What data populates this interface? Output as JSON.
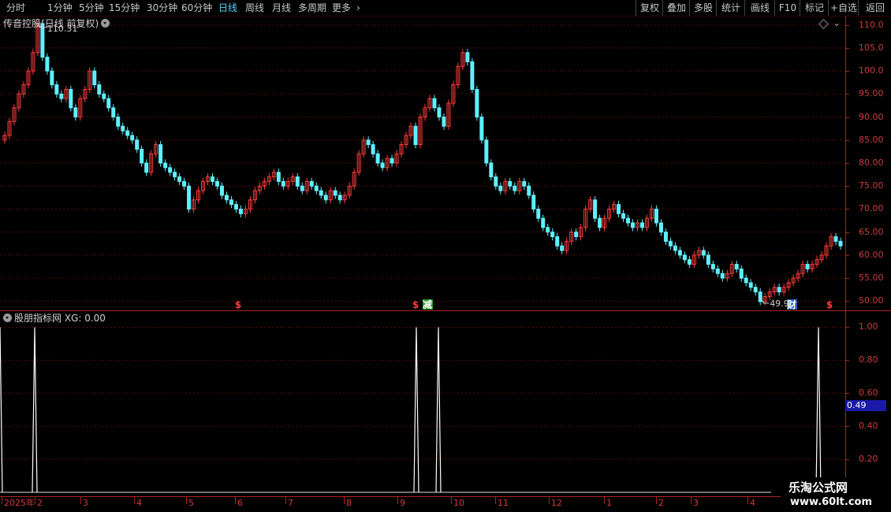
{
  "toolbar": {
    "periods": [
      "分时",
      "1分钟",
      "5分钟",
      "15分钟",
      "30分钟",
      "60分钟",
      "日线",
      "周线",
      "月线",
      "多周期",
      "更多"
    ],
    "active_period": "日线",
    "right_buttons": [
      "复权",
      "叠加",
      "多股",
      "统计",
      "画线",
      "F10",
      "标记",
      "+自选",
      "返回"
    ]
  },
  "main_panel": {
    "title": "传音控股(日线 前复权)",
    "high_label": "110.31",
    "low_label": "49.90",
    "y_ticks": [
      "110.0",
      "105.0",
      "100.0",
      "95.00",
      "90.00",
      "85.00",
      "80.00",
      "75.00",
      "70.00",
      "65.00",
      "60.00",
      "55.00",
      "50.00"
    ],
    "markers": [
      "$",
      "$",
      "减",
      "财",
      "$"
    ]
  },
  "indicator_panel": {
    "title": "股朋指标网 XG: 0.00",
    "y_ticks": [
      "1.00",
      "0.80",
      "0.60",
      "0.40",
      "0.20"
    ],
    "cursor_value": "0.49"
  },
  "date_axis": {
    "labels": [
      "2025年",
      "2",
      "3",
      "4",
      "5",
      "6",
      "7",
      "8",
      "9",
      "10",
      "11",
      "12",
      "1",
      "2",
      "3",
      "4"
    ]
  },
  "watermark": {
    "line1": "乐淘公式网",
    "line2": "www.60lt.com"
  },
  "chart_data": [
    {
      "type": "candlestick",
      "title": "传音控股(日线 前复权)",
      "ylim": [
        48,
        112
      ],
      "annotations": [
        {
          "label": "110.31",
          "kind": "high"
        },
        {
          "label": "49.90",
          "kind": "low"
        }
      ],
      "close": [
        86,
        89,
        92,
        95,
        97,
        100,
        104,
        110.31,
        103,
        100,
        97,
        95,
        94,
        96,
        92,
        90,
        94,
        96,
        100,
        97,
        95,
        94,
        92,
        90,
        88,
        87,
        86,
        85,
        83,
        80,
        78,
        82,
        84,
        80,
        79,
        78,
        77,
        76,
        75,
        70,
        72,
        74,
        76,
        77,
        76,
        75,
        73,
        72,
        71,
        70,
        69,
        70,
        72,
        74,
        75,
        76,
        77,
        78,
        76,
        75,
        76,
        77,
        75,
        74,
        76,
        75,
        74,
        73,
        72,
        74,
        73,
        72,
        73,
        75,
        78,
        82,
        85,
        84,
        82,
        80,
        79,
        81,
        80,
        82,
        84,
        86,
        88,
        84,
        90,
        92,
        94,
        92,
        90,
        88,
        93,
        97,
        101,
        104,
        102,
        96,
        90,
        85,
        80,
        77,
        75,
        74,
        76,
        75,
        74,
        76,
        75,
        73,
        70,
        68,
        66,
        65,
        64,
        62,
        61,
        63,
        65,
        64,
        66,
        70,
        72,
        68,
        66,
        68,
        70,
        71,
        69,
        68,
        67,
        66,
        67,
        66,
        68,
        70,
        67,
        65,
        63,
        62,
        61,
        60,
        59,
        58,
        60,
        61,
        60,
        58,
        57,
        56,
        55,
        56,
        58,
        57,
        55,
        54,
        53,
        52,
        49.9,
        51,
        52,
        53,
        52,
        53,
        54,
        55,
        56,
        58,
        57,
        58,
        59,
        60,
        62,
        64,
        63,
        62
      ]
    },
    {
      "type": "line",
      "title": "股朋指标网 XG",
      "ylim": [
        0,
        1.05
      ],
      "x": [
        0,
        44,
        528,
        556,
        1038
      ],
      "values": [
        1,
        1,
        1,
        1,
        1
      ]
    }
  ]
}
